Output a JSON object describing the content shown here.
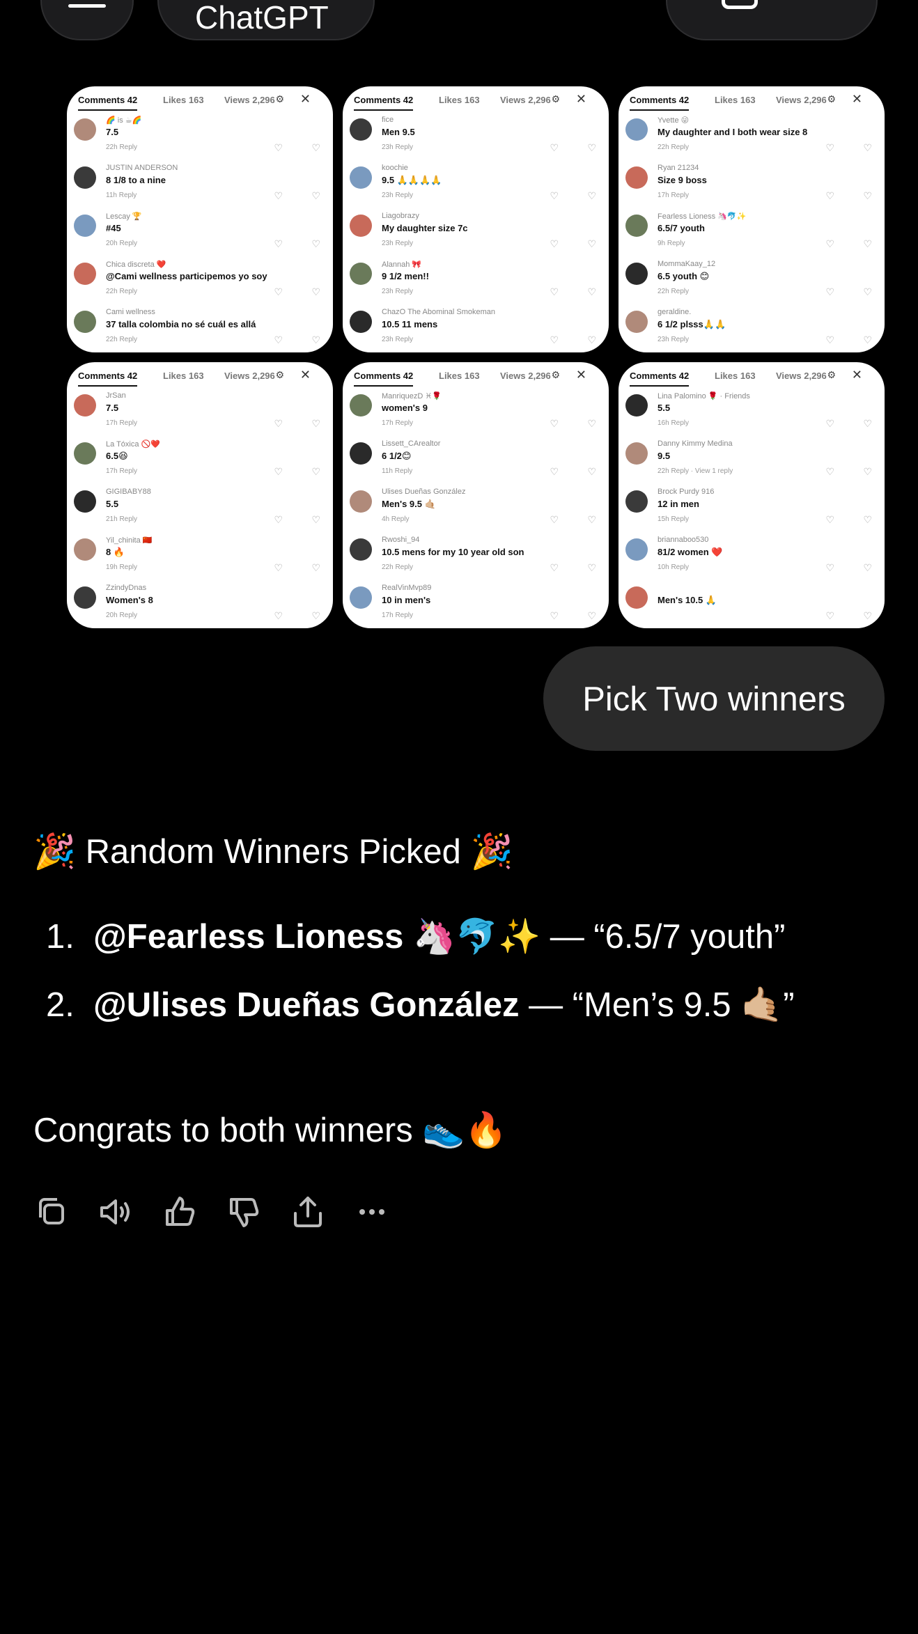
{
  "top_bar": {
    "model_label": "ChatGPT"
  },
  "screenshots": [
    {
      "header": {
        "comments": "Comments 42",
        "likes": "Likes 163",
        "views": "Views 2,296"
      },
      "comments": [
        {
          "name": "🌈 is ☕🌈",
          "text": "7.5",
          "meta": "22h  Reply"
        },
        {
          "name": "JUSTIN ANDERSON",
          "text": "8 1/8 to a nine",
          "meta": "11h  Reply"
        },
        {
          "name": "Lescay 🏆",
          "text": "#45",
          "meta": "20h  Reply"
        },
        {
          "name": "Chica discreta ❤️",
          "text": "@Cami wellness participemos yo soy",
          "meta": "22h  Reply"
        },
        {
          "name": "Cami wellness",
          "text": "37 talla colombia no sé cuál es allá",
          "meta": "22h  Reply"
        }
      ]
    },
    {
      "header": {
        "comments": "Comments 42",
        "likes": "Likes 163",
        "views": "Views 2,296"
      },
      "comments": [
        {
          "name": "fice",
          "text": "Men 9.5",
          "meta": "23h  Reply"
        },
        {
          "name": "koochie",
          "text": "9.5 🙏🙏🙏🙏",
          "meta": "23h  Reply"
        },
        {
          "name": "Liagobrazy",
          "text": "My daughter size 7c",
          "meta": "23h  Reply"
        },
        {
          "name": "Alannah 🎀",
          "text": "9 1/2 men!!",
          "meta": "23h  Reply"
        },
        {
          "name": "ChazO The Abominal Smokeman",
          "text": "10.5 11 mens",
          "meta": "23h  Reply"
        }
      ]
    },
    {
      "header": {
        "comments": "Comments 42",
        "likes": "Likes 163",
        "views": "Views 2,296"
      },
      "comments": [
        {
          "name": "Yvette 😜",
          "text": "My daughter and I both wear size 8",
          "meta": "22h  Reply"
        },
        {
          "name": "Ryan 21234",
          "text": "Size 9 boss",
          "meta": "17h  Reply"
        },
        {
          "name": "Fearless Lioness 🦄🐬✨",
          "text": "6.5/7 youth",
          "meta": "9h  Reply"
        },
        {
          "name": "MommaKaay_12",
          "text": "6.5 youth 😊",
          "meta": "22h  Reply"
        },
        {
          "name": "geraldine.",
          "text": "6 1/2 plsss🙏🙏",
          "meta": "23h  Reply"
        }
      ]
    },
    {
      "header": {
        "comments": "Comments 42",
        "likes": "Likes 163",
        "views": "Views 2,296"
      },
      "comments": [
        {
          "name": "JrSan",
          "text": "7.5",
          "meta": "17h  Reply"
        },
        {
          "name": "La Tóxica 🚫❤️",
          "text": "6.5😆",
          "meta": "17h  Reply"
        },
        {
          "name": "GIGIBABY88",
          "text": "5.5",
          "meta": "21h  Reply"
        },
        {
          "name": "Yil_chinita 🇨🇳",
          "text": "8 🔥",
          "meta": "19h  Reply"
        },
        {
          "name": "ZzindyDnas",
          "text": "Women's 8",
          "meta": "20h  Reply"
        }
      ]
    },
    {
      "header": {
        "comments": "Comments 42",
        "likes": "Likes 163",
        "views": "Views 2,296"
      },
      "comments": [
        {
          "name": "ManriquezD ♓🌹",
          "text": "women's 9",
          "meta": "17h  Reply"
        },
        {
          "name": "Lissett_CArealtor",
          "text": "6 1/2😊",
          "meta": "11h  Reply"
        },
        {
          "name": "Ulises Dueñas González",
          "text": "Men's 9.5 🤙🏼",
          "meta": "4h  Reply"
        },
        {
          "name": "Rwoshi_94",
          "text": "10.5 mens for my 10 year old son",
          "meta": "22h  Reply"
        },
        {
          "name": "RealVinMvp89",
          "text": "10 in men's",
          "meta": "17h  Reply"
        }
      ]
    },
    {
      "header": {
        "comments": "Comments 42",
        "likes": "Likes 163",
        "views": "Views 2,296"
      },
      "comments": [
        {
          "name": "Lina Palomino 🌹 · Friends",
          "text": "5.5",
          "meta": "16h  Reply"
        },
        {
          "name": "Danny Kimmy Medina",
          "text": "9.5",
          "meta": "22h  Reply · View 1 reply"
        },
        {
          "name": "Brock Purdy 916",
          "text": "12 in men",
          "meta": "15h  Reply"
        },
        {
          "name": "briannaboo530",
          "text": "81/2 women ❤️",
          "meta": "10h  Reply"
        },
        {
          "name": "",
          "text": "Men's 10.5 🙏",
          "meta": ""
        }
      ]
    }
  ],
  "user_message": "Pick Two winners",
  "response": {
    "heading": "🎉 Random Winners Picked 🎉",
    "winners": [
      {
        "number": "1.",
        "name": "@Fearless Lioness",
        "emoji": " 🦄🐬✨",
        "quote": " — “6.5/7 youth”"
      },
      {
        "number": "2.",
        "name": "@Ulises Dueñas González",
        "emoji": "",
        "quote": " — “Men’s 9.5 🤙🏼”"
      }
    ],
    "congrats": "Congrats to both winners 👟🔥"
  },
  "actions": [
    "copy-icon",
    "read-aloud-icon",
    "thumbs-up-icon",
    "thumbs-down-icon",
    "share-icon",
    "more-icon"
  ]
}
